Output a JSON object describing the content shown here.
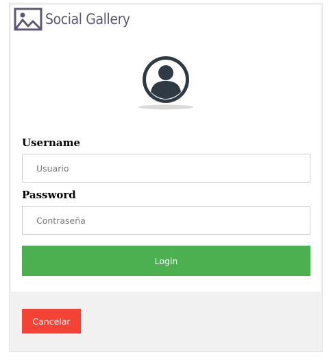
{
  "brand": {
    "name": "Social Gallery",
    "icon": "image-icon",
    "color": "#5d5670"
  },
  "avatar": {
    "icon": "user-circle-icon"
  },
  "form": {
    "username_label": "Username",
    "username_placeholder": "Usuario",
    "username_value": "",
    "password_label": "Password",
    "password_placeholder": "Contraseña",
    "password_value": ""
  },
  "buttons": {
    "login_label": "Login",
    "login_color": "#4caf50",
    "cancel_label": "Cancelar",
    "cancel_color": "#f44336"
  }
}
